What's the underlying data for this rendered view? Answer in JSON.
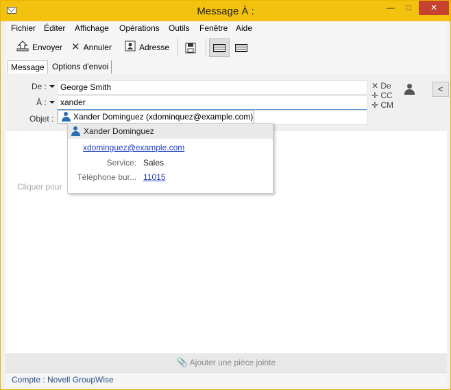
{
  "window": {
    "title": "Message À :",
    "controls": {
      "minimize": "—",
      "maximize": "□",
      "close": "✕"
    }
  },
  "menu": [
    "Fichier",
    "Éditer",
    "Affichage",
    "Opérations",
    "Outils",
    "Fenêtre",
    "Aide"
  ],
  "toolbar": {
    "send": "Envoyer",
    "cancel": "Annuler",
    "address": "Adresse"
  },
  "tabs": [
    "Message",
    "Options d'envoi"
  ],
  "header": {
    "from_label": "De :",
    "from_value": "George Smith",
    "to_label": "À :",
    "to_value": "xander",
    "subject_label": "Objet :",
    "links": {
      "de": "De",
      "cc": "CC",
      "cm": "CM"
    }
  },
  "autocomplete": {
    "suggestion": "Xander Dominguez (xdominquez@example.com)"
  },
  "contact_card": {
    "name": "Xander Dominguez",
    "email": "xdominguez@example.com",
    "service_label": "Service:",
    "service_value": "Sales",
    "phone_label": "Téléphone bur...",
    "phone_value": "11015"
  },
  "body": {
    "placeholder": "Cliquer pour"
  },
  "attach": "Ajouter une pièce jointe",
  "status": "Compte : Novell GroupWise",
  "colors": {
    "titlebar": "#f3c20e",
    "close": "#c7412f",
    "person_icon": "#2a6fb5",
    "link": "#1f3fbf"
  }
}
